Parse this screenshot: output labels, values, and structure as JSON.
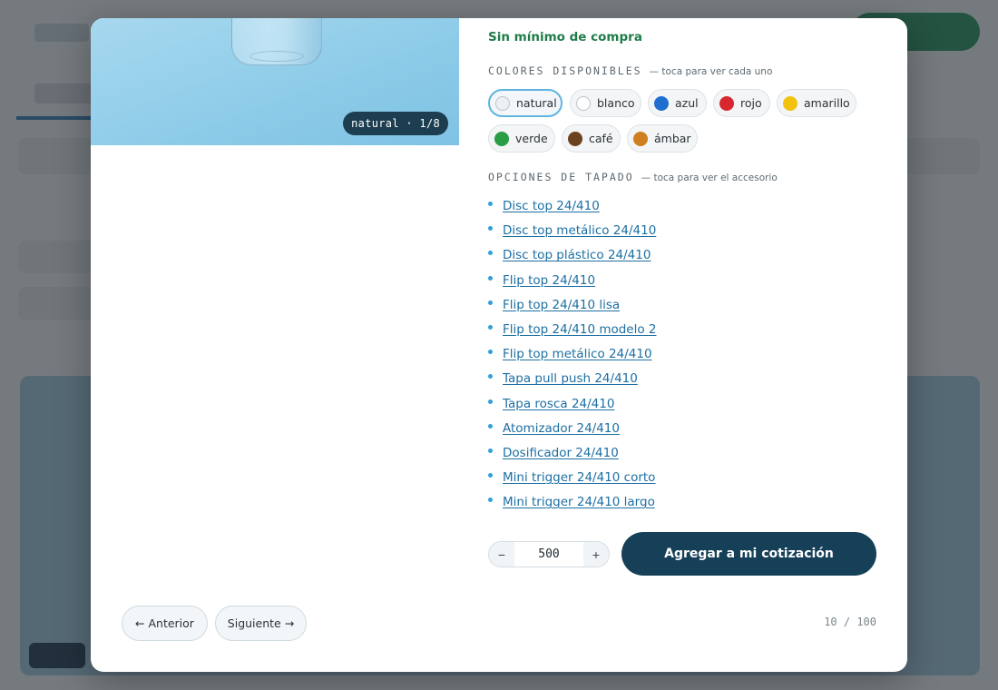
{
  "product_image": {
    "color_label": "natural",
    "separator": "·",
    "position": "1/8"
  },
  "min_purchase": "Sin mínimo de compra",
  "colors": {
    "label": "COLORES DISPONIBLES",
    "hint": "— toca para ver cada uno",
    "selected": "natural",
    "options": [
      {
        "label": "natural",
        "color": "#eef1f4"
      },
      {
        "label": "blanco",
        "color": "#ffffff"
      },
      {
        "label": "azul",
        "color": "#1f6fd1"
      },
      {
        "label": "rojo",
        "color": "#d8282f"
      },
      {
        "label": "amarillo",
        "color": "#f2c20c"
      },
      {
        "label": "verde",
        "color": "#2a9d45"
      },
      {
        "label": "café",
        "color": "#6b4320"
      },
      {
        "label": "ámbar",
        "color": "#cf7f1f"
      }
    ]
  },
  "caps": {
    "label": "OPCIONES DE TAPADO",
    "hint": "— toca para ver el accesorio",
    "items": [
      "Disc top 24/410",
      "Disc top metálico 24/410",
      "Disc top plástico 24/410",
      "Flip top 24/410",
      "Flip top 24/410 lisa",
      "Flip top 24/410 modelo 2",
      "Flip top metálico 24/410",
      "Tapa pull push 24/410",
      "Tapa rosca 24/410",
      "Atomizador 24/410",
      "Dosificador 24/410",
      "Mini trigger 24/410 corto",
      "Mini trigger 24/410 largo"
    ]
  },
  "quantity": {
    "decrement": "−",
    "value": "500",
    "increment": "+"
  },
  "add_button": "Agregar a mi cotización",
  "nav": {
    "prev": "← Anterior",
    "next": "Siguiente →"
  },
  "counter": "10 / 100",
  "theme": {
    "primary": "#163f58",
    "accent_green": "#1f7c49",
    "link": "#1c6fa3",
    "selected_border": "#5fb4e2"
  }
}
